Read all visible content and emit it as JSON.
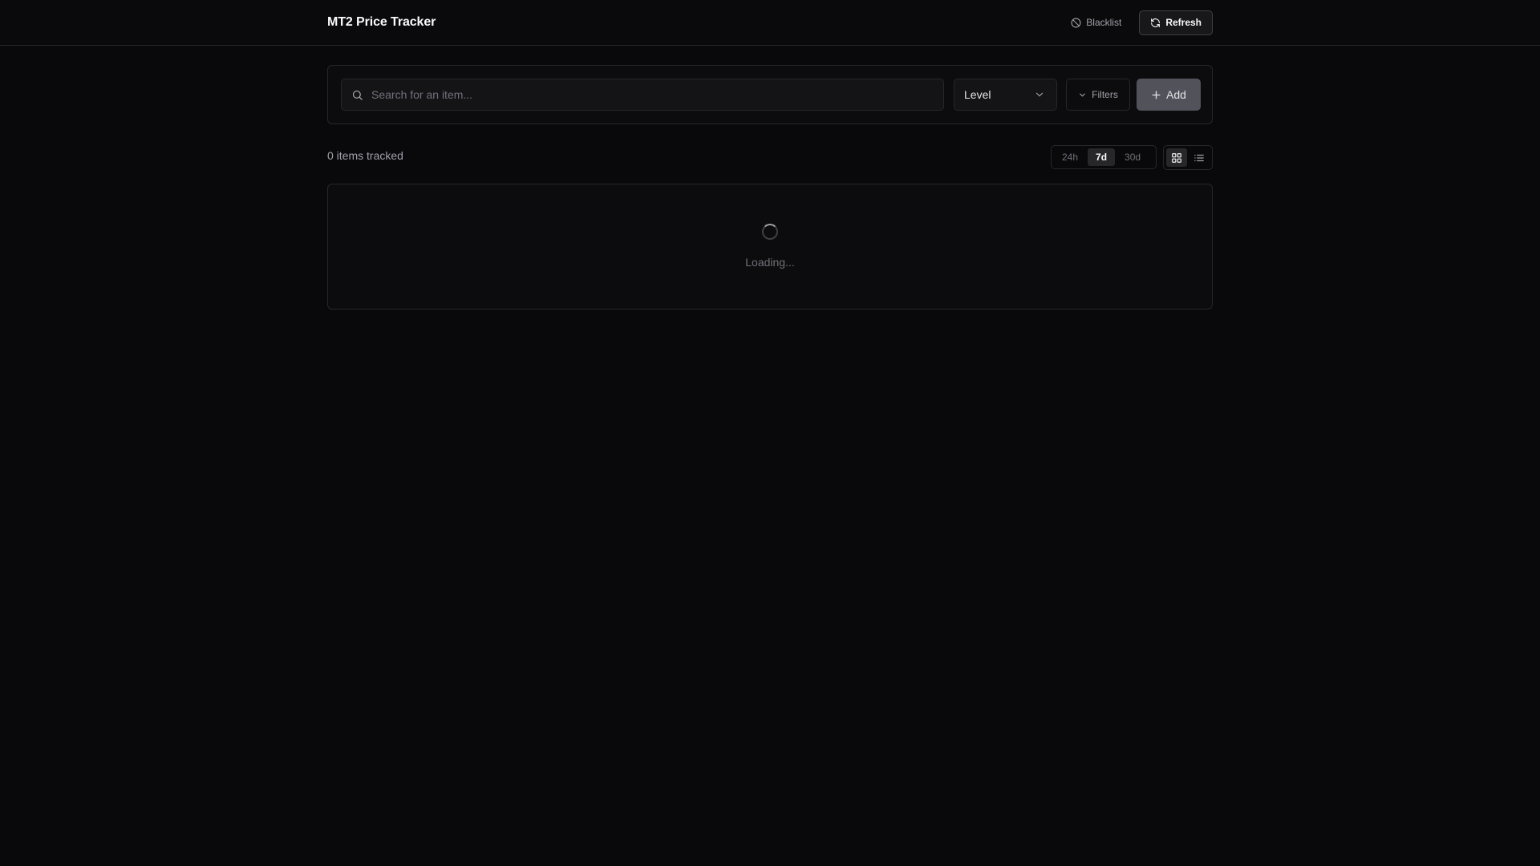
{
  "header": {
    "title": "MT2 Price Tracker",
    "blacklist_label": "Blacklist",
    "refresh_label": "Refresh"
  },
  "search": {
    "placeholder": "Search for an item...",
    "value": "",
    "level_selected": "Level",
    "filters_label": "Filters",
    "add_label": "Add"
  },
  "summary": {
    "count_text": "0 items tracked"
  },
  "time_ranges": {
    "options": [
      "24h",
      "7d",
      "30d"
    ],
    "selected": "7d"
  },
  "view_modes": {
    "selected": "grid",
    "icons": [
      "grid-icon",
      "list-icon"
    ]
  },
  "status": {
    "loading_text": "Loading..."
  },
  "colors": {
    "background": "#09090b",
    "panel": "#0c0c0e",
    "border": "#27272a",
    "accent_button": "#52525b"
  }
}
